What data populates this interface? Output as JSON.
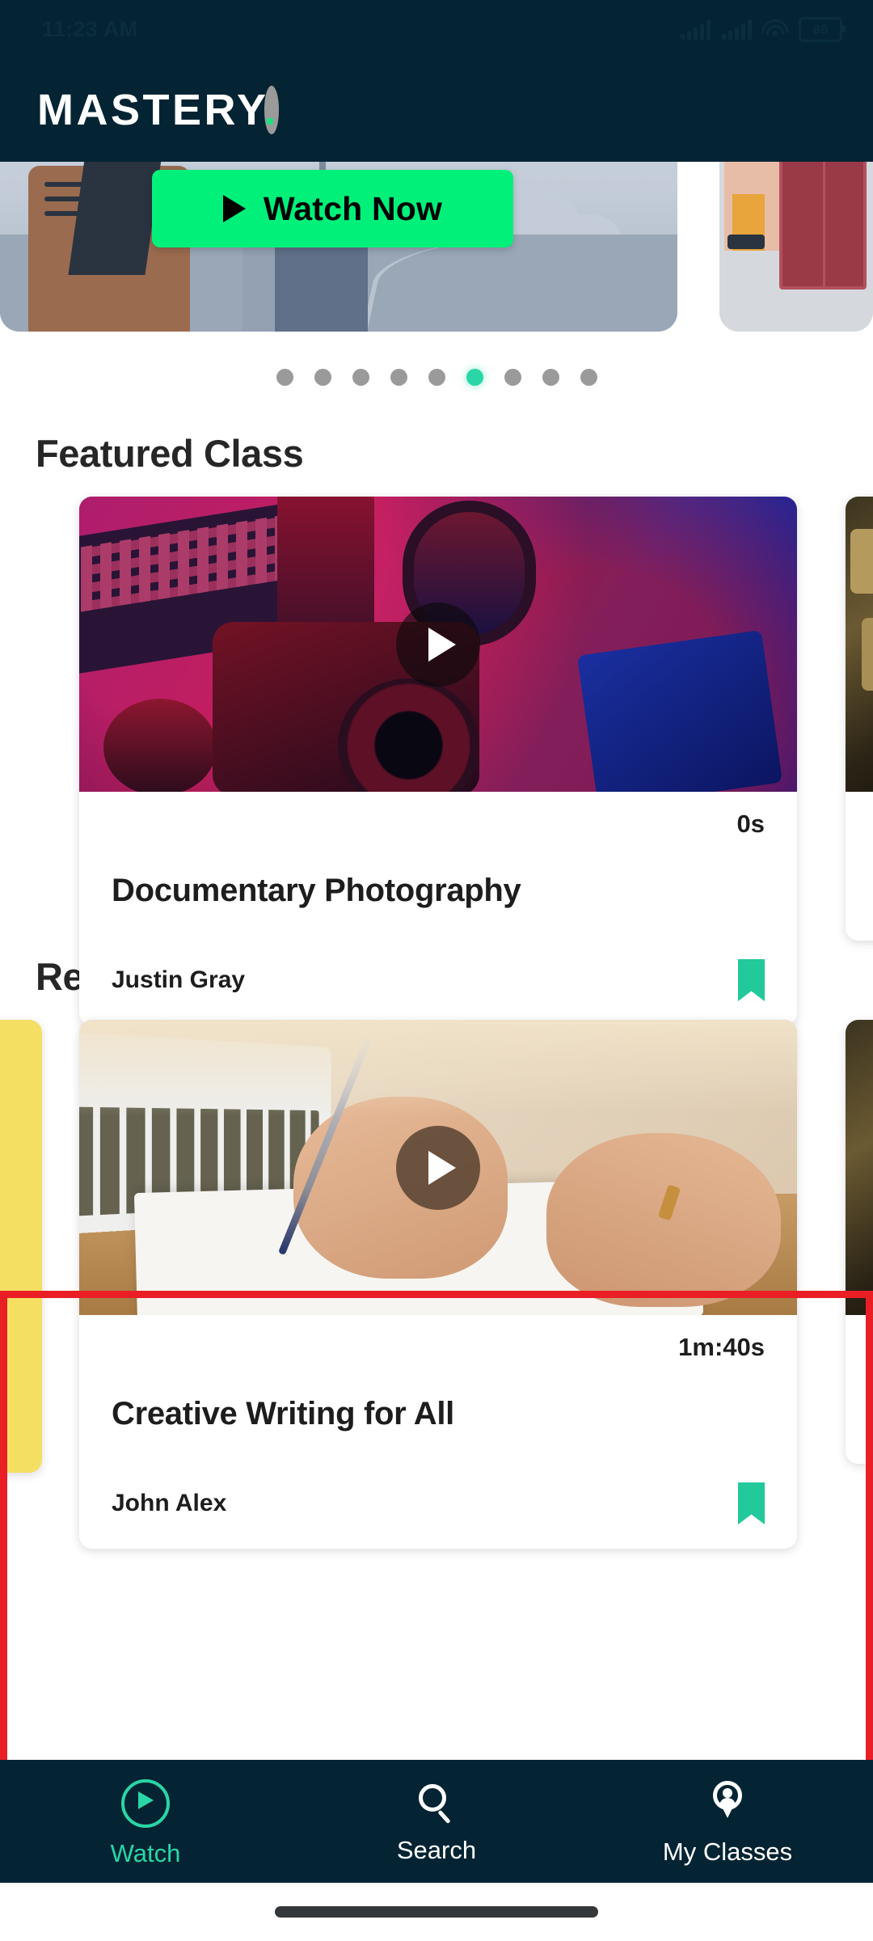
{
  "status_bar": {
    "time": "11:23 AM",
    "battery_level": "86",
    "icons": [
      "signal-icon",
      "signal-icon",
      "wifi-icon",
      "battery-icon"
    ]
  },
  "header": {
    "logo_text": "MASTERY",
    "logo_dot": ".",
    "accent_color": "#19e27f",
    "background_color": "#042433"
  },
  "banner": {
    "cta_label": "Watch Now",
    "cta_color": "#00f07a",
    "carousel": {
      "total_dots": 9,
      "active_index": 5,
      "active_color": "#2ad6a6",
      "inactive_color": "#9a9a9a"
    }
  },
  "sections": [
    {
      "title": "Featured Class",
      "cards": [
        {
          "duration": "0s",
          "title": "Documentary Photography",
          "author": "Justin Gray",
          "bookmark_color": "#22c99a",
          "thumbnail": "camera-neon-photo"
        }
      ]
    },
    {
      "title": "Recommended For You",
      "cards": [
        {
          "duration": "1m:40s",
          "title": "Creative Writing for All",
          "author": "John Alex",
          "bookmark_color": "#22c99a",
          "thumbnail": "hands-writing-photo"
        }
      ]
    }
  ],
  "highlight": {
    "color": "#ea1f26",
    "target_section": "Recommended For You"
  },
  "bottom_nav": {
    "items": [
      {
        "label": "Watch",
        "icon": "play-circle-icon",
        "active": true
      },
      {
        "label": "Search",
        "icon": "search-icon",
        "active": false
      },
      {
        "label": "My Classes",
        "icon": "location-pin-person-icon",
        "active": false
      }
    ],
    "active_color": "#2ad6a6",
    "background_color": "#042433"
  }
}
